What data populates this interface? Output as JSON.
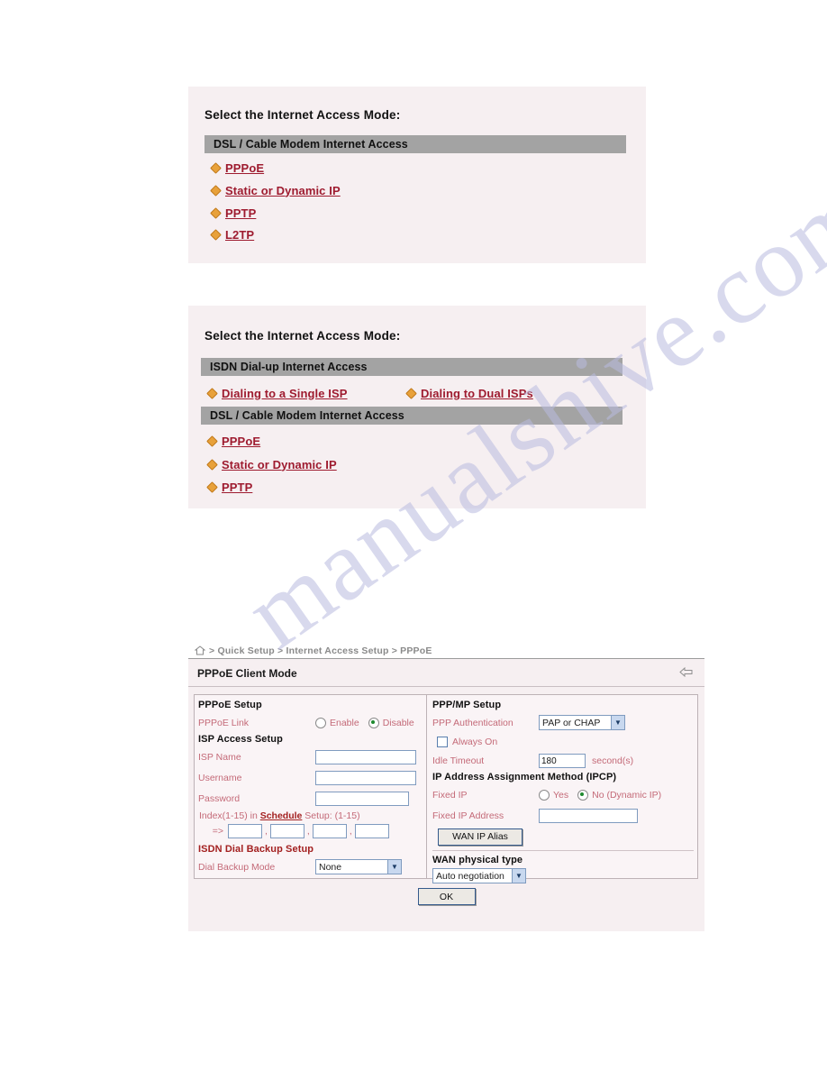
{
  "watermark": {
    "text": "manualshive.com"
  },
  "panel_one": {
    "title": "Select the Internet Access Mode:",
    "sections": [
      {
        "header": "DSL / Cable Modem Internet Access",
        "links": [
          "PPPoE",
          "Static or Dynamic IP",
          "PPTP",
          "L2TP"
        ]
      }
    ]
  },
  "panel_two": {
    "title": "Select the Internet Access Mode:",
    "isdn_header": "ISDN Dial-up Internet Access",
    "isdn_links": [
      "Dialing to a Single ISP",
      "Dialing to Dual ISPs"
    ],
    "dsl_header": "DSL / Cable Modem Internet Access",
    "dsl_links": [
      "PPPoE",
      "Static or Dynamic IP",
      "PPTP"
    ]
  },
  "router_page": {
    "breadcrumb": "> Quick Setup > Internet Access Setup > PPPoE",
    "home_icon": "home-icon",
    "back_icon": "back-arrow-icon",
    "page_title": "PPPoE Client Mode",
    "left": {
      "pppoe_setup_header": "PPPoE Setup",
      "pppoe_link_label": "PPPoE Link",
      "pppoe_link_options": [
        "Enable",
        "Disable"
      ],
      "pppoe_link_selected": "Disable",
      "isp_access_header": "ISP Access Setup",
      "isp_name_label": "ISP Name",
      "isp_name_value": "",
      "username_label": "Username",
      "username_value": "",
      "password_label": "Password",
      "password_value": "",
      "schedule_prefix": "Index(1-15) in ",
      "schedule_link": "Schedule",
      "schedule_suffix": " Setup: (1-15)",
      "schedule_arrow": "=>",
      "schedule_values": [
        "",
        "",
        "",
        ""
      ],
      "schedule_separator": ",",
      "isdn_backup_header": "ISDN Dial Backup Setup",
      "dial_backup_label": "Dial Backup Mode",
      "dial_backup_value": "None"
    },
    "right": {
      "ppp_mp_header": "PPP/MP Setup",
      "ppp_auth_label": "PPP Authentication",
      "ppp_auth_value": "PAP or CHAP",
      "always_on_label": "Always On",
      "always_on_checked": false,
      "idle_timeout_label": "Idle Timeout",
      "idle_timeout_value": "180",
      "idle_timeout_unit": "second(s)",
      "ipcp_header": "IP Address Assignment Method (IPCP)",
      "fixed_ip_label": "Fixed IP",
      "fixed_ip_options": [
        "Yes",
        "No (Dynamic IP)"
      ],
      "fixed_ip_selected": "No (Dynamic IP)",
      "fixed_ip_address_label": "Fixed IP Address",
      "fixed_ip_address_value": "",
      "wan_ip_alias_button": "WAN IP Alias",
      "wan_physical_header": "WAN physical type",
      "wan_physical_value": "Auto negotiation"
    },
    "ok_button": "OK"
  },
  "colors": {
    "panel_bg": "#f6eff1",
    "section_bar": "#a3a3a3",
    "link": "#9e1b2f",
    "field_label": "#c46a78",
    "group_header_red": "#a32020",
    "watermark": "#b9bbe0"
  }
}
